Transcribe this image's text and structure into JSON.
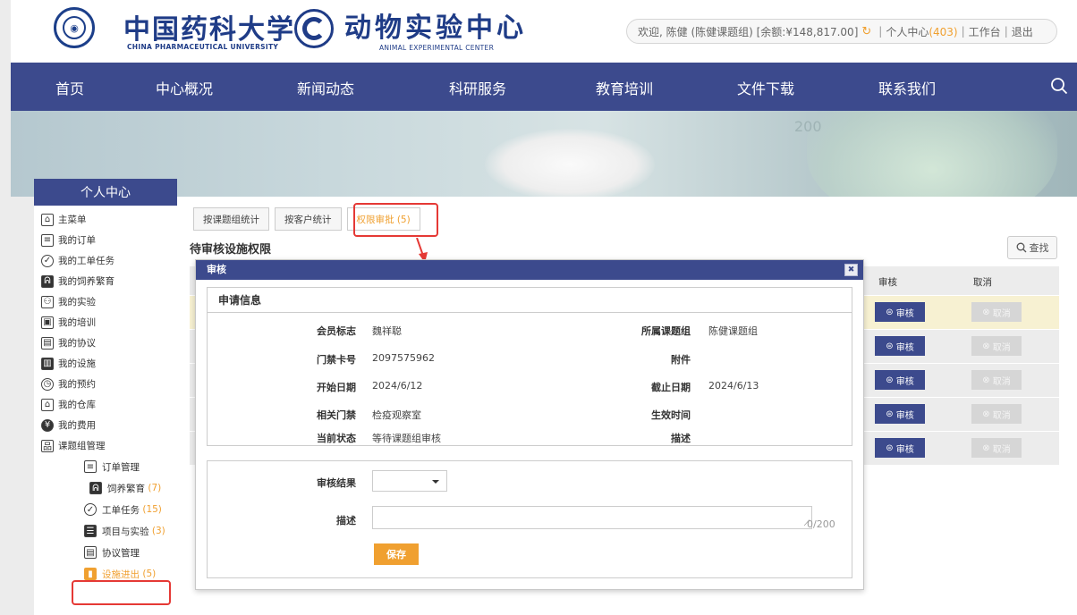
{
  "header": {
    "logo1_cn": "中国药科大学",
    "logo1_en": "CHINA PHARMACEUTICAL UNIVERSITY",
    "logo2_cn": "动物实验中心",
    "logo2_en": "ANIMAL EXPERIMENTAL CENTER",
    "welcome": "欢迎, 陈健 (陈健课题组) [余额:¥148,817.00]",
    "personal_center": "个人中心",
    "personal_center_count": "(403)",
    "workbench": "工作台",
    "logout": "退出"
  },
  "nav": {
    "items": [
      "首页",
      "中心概况",
      "新闻动态",
      "科研服务",
      "教育培训",
      "文件下载",
      "联系我们"
    ]
  },
  "banner": {
    "mark": "200"
  },
  "sidebar": {
    "title": "个人中心",
    "items": [
      {
        "label": "主菜单",
        "icon": "home-icon"
      },
      {
        "label": "我的订单",
        "icon": "list-icon"
      },
      {
        "label": "我的工单任务",
        "icon": "check-icon"
      },
      {
        "label": "我的饲养繁育",
        "icon": "mouse-icon"
      },
      {
        "label": "我的实验",
        "icon": "people-icon"
      },
      {
        "label": "我的培训",
        "icon": "training-icon"
      },
      {
        "label": "我的协议",
        "icon": "doc-icon"
      },
      {
        "label": "我的设施",
        "icon": "facility-icon"
      },
      {
        "label": "我的预约",
        "icon": "clock-icon"
      },
      {
        "label": "我的仓库",
        "icon": "warehouse-icon"
      },
      {
        "label": "我的费用",
        "icon": "yen-icon"
      },
      {
        "label": "课题组管理",
        "icon": "org-icon"
      }
    ],
    "sub_items": [
      {
        "label": "订单管理",
        "count": "",
        "icon": "list-icon"
      },
      {
        "label": "饲养繁育",
        "count": "(7)",
        "icon": "mouse-icon"
      },
      {
        "label": "工单任务",
        "count": "(15)",
        "icon": "check-icon"
      },
      {
        "label": "项目与实验",
        "count": "(3)",
        "icon": "project-icon"
      },
      {
        "label": "协议管理",
        "count": "",
        "icon": "doc-icon"
      },
      {
        "label": "设施进出",
        "count": "(5)",
        "icon": "door-icon"
      }
    ]
  },
  "main": {
    "tabs": [
      "按课题组统计",
      "按客户统计",
      "权限审批 (5)"
    ],
    "title": "待审核设施权限",
    "find": "查找",
    "columns": {
      "audit": "审核",
      "cancel": "取消"
    },
    "audit_label": "审核",
    "cancel_label": "取消",
    "row_count": 5
  },
  "modal": {
    "title": "审核",
    "section": "申请信息",
    "fields": {
      "member_label": "会员标志",
      "member_value": "魏祥聪",
      "group_label": "所属课题组",
      "group_value": "陈健课题组",
      "card_label": "门禁卡号",
      "card_value": "2097575962",
      "attach_label": "附件",
      "attach_value": "",
      "start_label": "开始日期",
      "start_value": "2024/6/12",
      "end_label": "截止日期",
      "end_value": "2024/6/13",
      "door_label": "相关门禁",
      "door_value": "检疫观察室",
      "effective_label": "生效时间",
      "effective_value": "",
      "status_label": "当前状态",
      "status_value": "等待课题组审核",
      "desc_label": "描述",
      "desc_value": ""
    },
    "form": {
      "result_label": "审核结果",
      "result_value": "",
      "desc_label": "描述",
      "desc_value": "",
      "counter": "0/200",
      "save": "保存"
    }
  }
}
